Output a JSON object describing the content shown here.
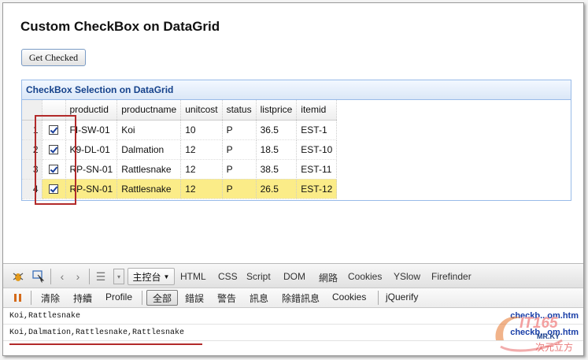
{
  "page": {
    "title": "Custom CheckBox on DataGrid",
    "button_label": "Get Checked"
  },
  "grid": {
    "panel_title": "CheckBox Selection on DataGrid",
    "columns": [
      "productid",
      "productname",
      "unitcost",
      "status",
      "listprice",
      "itemid"
    ],
    "rows": [
      {
        "num": "1",
        "checked": true,
        "cells": [
          "FI-SW-01",
          "Koi",
          "10",
          "P",
          "36.5",
          "EST-1"
        ]
      },
      {
        "num": "2",
        "checked": true,
        "cells": [
          "K9-DL-01",
          "Dalmation",
          "12",
          "P",
          "18.5",
          "EST-10"
        ]
      },
      {
        "num": "3",
        "checked": true,
        "cells": [
          "RP-SN-01",
          "Rattlesnake",
          "12",
          "P",
          "38.5",
          "EST-11"
        ]
      },
      {
        "num": "4",
        "checked": true,
        "selected": true,
        "cells": [
          "RP-SN-01",
          "Rattlesnake",
          "12",
          "P",
          "26.5",
          "EST-12"
        ]
      }
    ]
  },
  "firebug": {
    "console_label": "主控台",
    "tabs": [
      "HTML",
      "CSS",
      "Script",
      "DOM",
      "網路",
      "Cookies",
      "YSlow",
      "Firefinder"
    ],
    "filters": {
      "clear": "清除",
      "persist": "持續",
      "profile": "Profile",
      "all": "全部",
      "errors": "錯誤",
      "warnings": "警告",
      "info": "訊息",
      "debug": "除錯訊息",
      "cookies": "Cookies",
      "jquerify": "jQuerify"
    },
    "logs": [
      {
        "text": "Koi,Rattlesnake",
        "source": "checkb...om.htm"
      },
      {
        "text": "Koi,Dalmation,Rattlesnake,Rattlesnake",
        "source": "checkb...om.htm"
      }
    ]
  },
  "watermark": {
    "text1": "IT165",
    "text2": "MR.KY",
    "text3": "次元立方"
  }
}
